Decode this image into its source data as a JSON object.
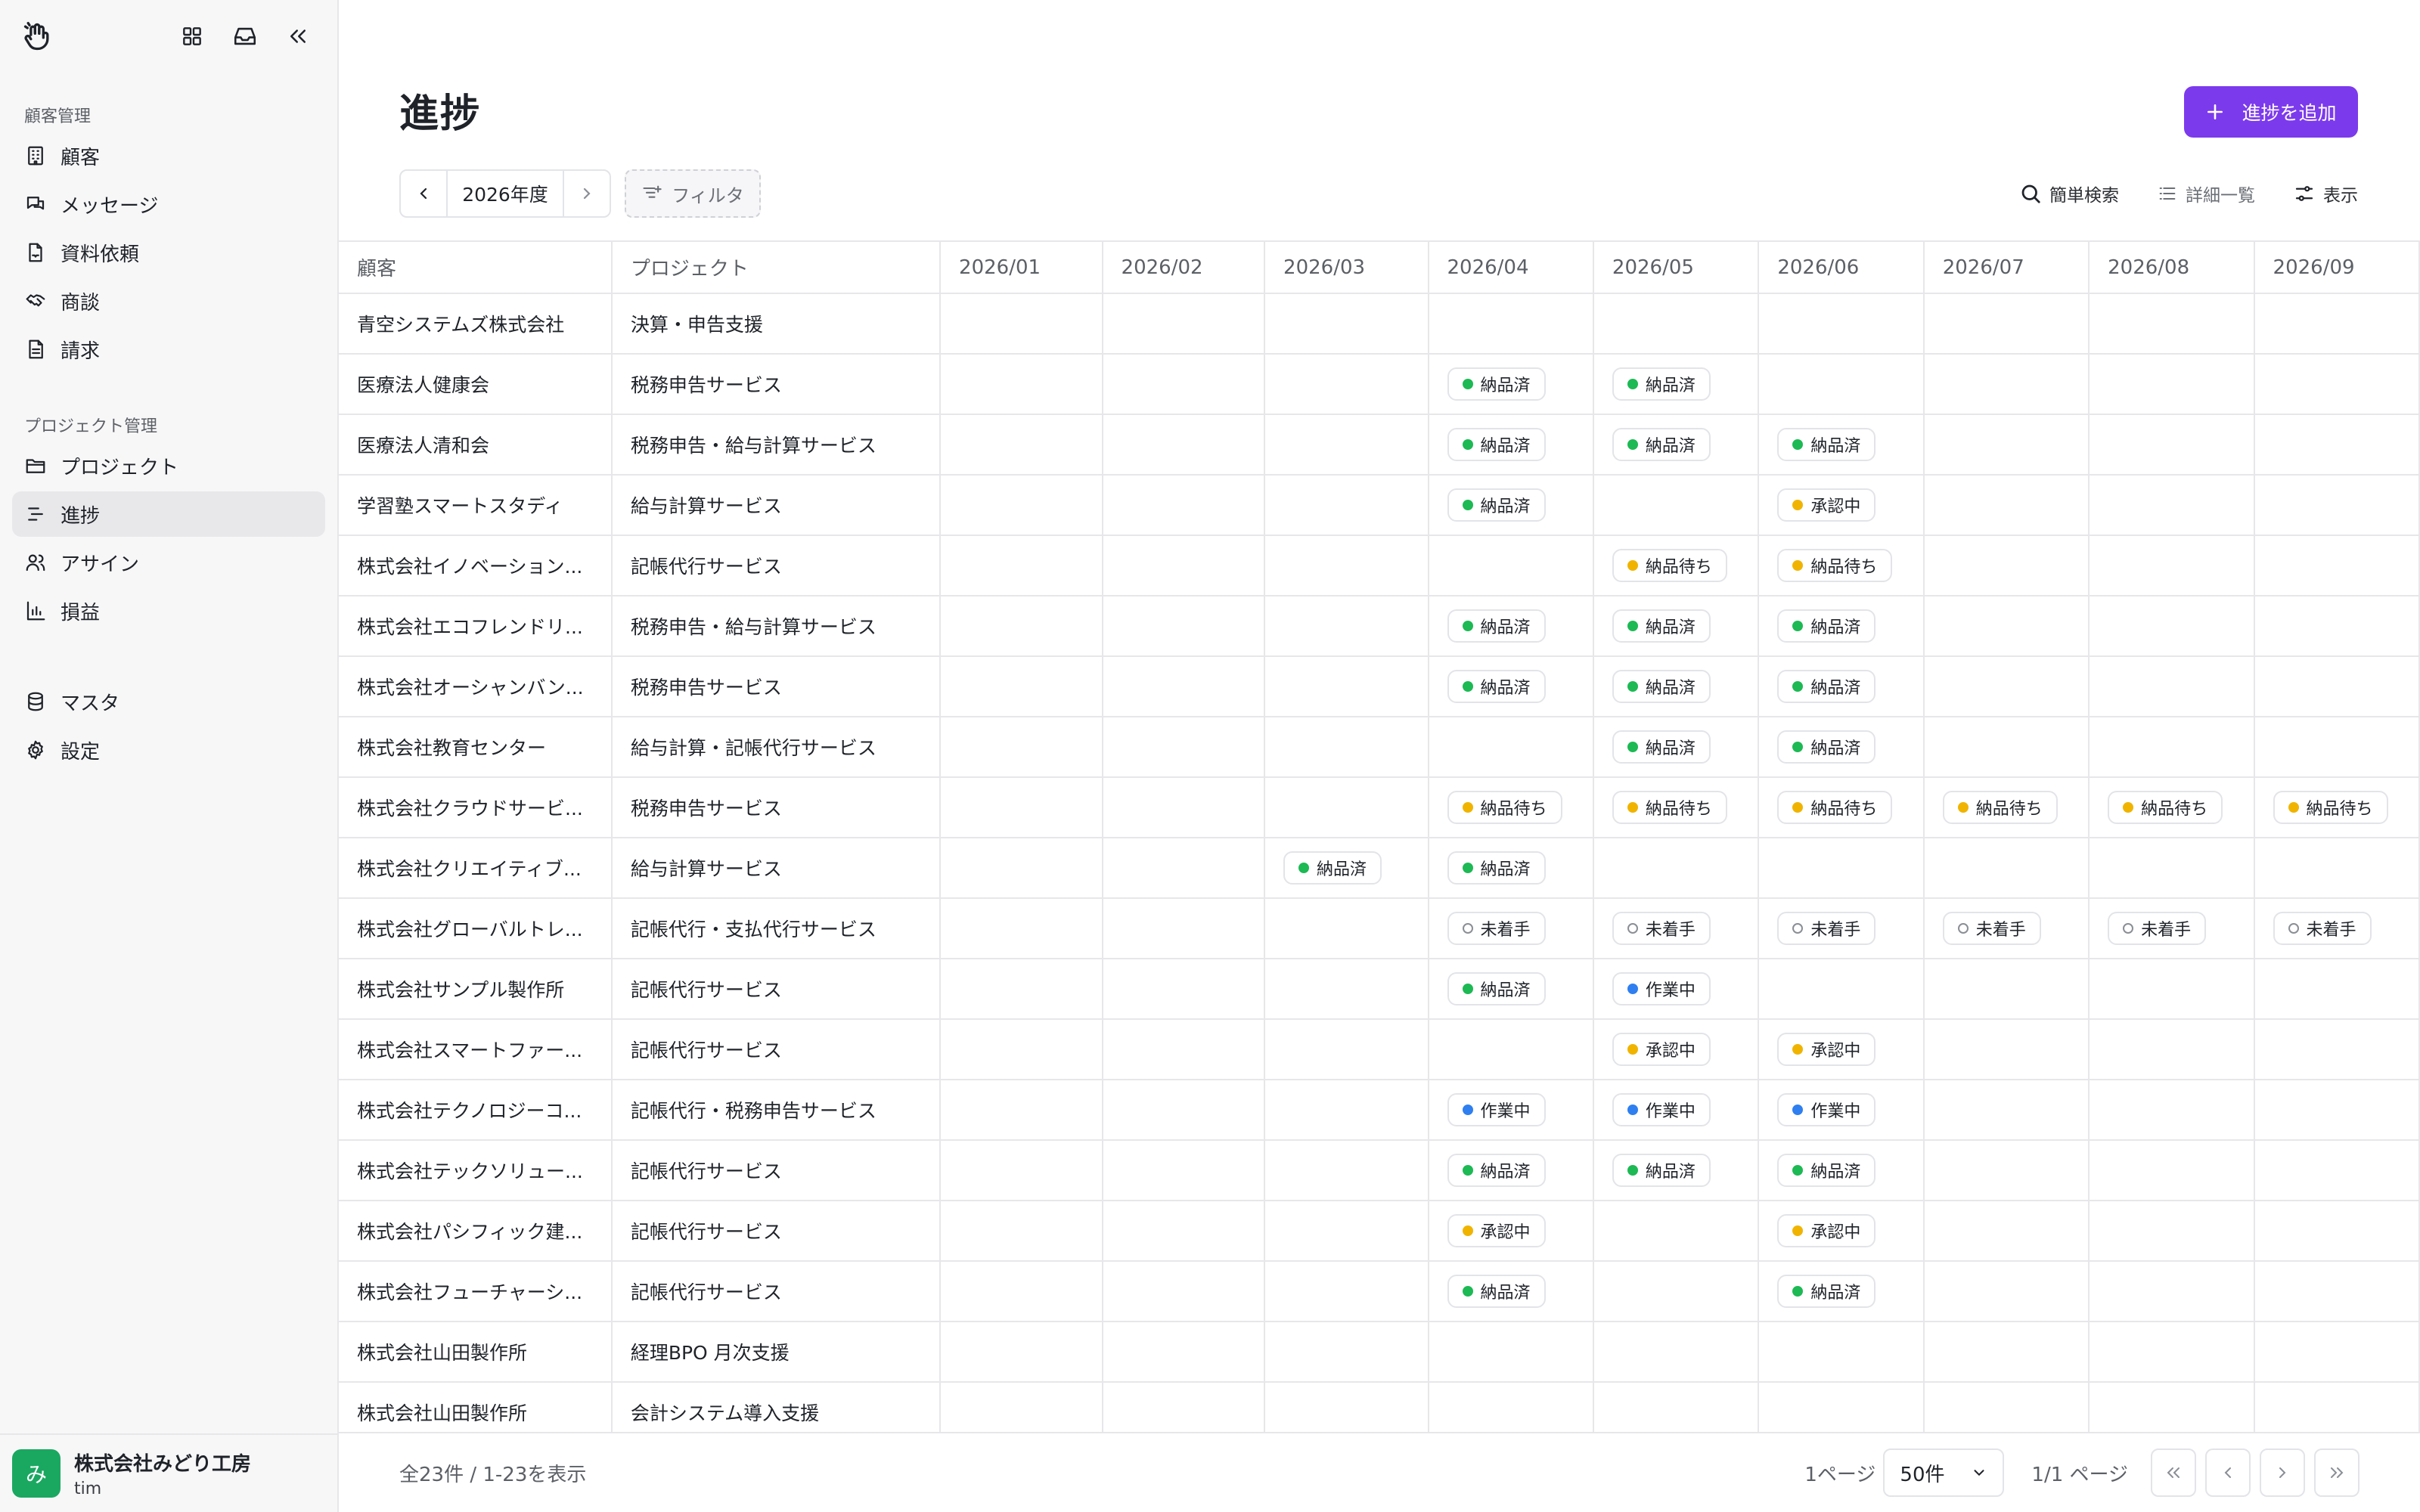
{
  "sidebar": {
    "sections": [
      {
        "title": "顧客管理",
        "items": [
          {
            "label": "顧客",
            "icon": "building-icon"
          },
          {
            "label": "メッセージ",
            "icon": "message-icon"
          },
          {
            "label": "資料依頼",
            "icon": "file-inbox-icon"
          },
          {
            "label": "商談",
            "icon": "handshake-icon"
          },
          {
            "label": "請求",
            "icon": "invoice-icon"
          }
        ]
      },
      {
        "title": "プロジェクト管理",
        "items": [
          {
            "label": "プロジェクト",
            "icon": "folder-icon"
          },
          {
            "label": "進捗",
            "icon": "progress-icon",
            "active": true
          },
          {
            "label": "アサイン",
            "icon": "users-icon"
          },
          {
            "label": "損益",
            "icon": "bar-chart-icon"
          }
        ]
      },
      {
        "title": "",
        "items": [
          {
            "label": "マスタ",
            "icon": "database-icon"
          },
          {
            "label": "設定",
            "icon": "gear-icon"
          }
        ]
      }
    ],
    "footer": {
      "avatar": "み",
      "org": "株式会社みどり工房",
      "user": "tim"
    }
  },
  "header": {
    "title": "進捗",
    "add_button": "進捗を追加"
  },
  "toolbar": {
    "year": "2026年度",
    "filter": "フィルタ",
    "quick_search": "簡単検索",
    "detail_list": "詳細一覧",
    "display": "表示"
  },
  "table": {
    "columns": [
      "顧客",
      "プロジェクト",
      "2026/01",
      "2026/02",
      "2026/03",
      "2026/04",
      "2026/05",
      "2026/06",
      "2026/07",
      "2026/08",
      "2026/09"
    ],
    "rows": [
      {
        "customer": "青空システムズ株式会社",
        "project": "決算・申告支援",
        "months": [
          "",
          "",
          "",
          "",
          "",
          "",
          "",
          "",
          ""
        ]
      },
      {
        "customer": "医療法人健康会",
        "project": "税務申告サービス",
        "months": [
          "",
          "",
          "",
          "納品済",
          "納品済",
          "",
          "",
          "",
          ""
        ]
      },
      {
        "customer": "医療法人清和会",
        "project": "税務申告・給与計算サービス",
        "months": [
          "",
          "",
          "",
          "納品済",
          "納品済",
          "納品済",
          "",
          "",
          ""
        ]
      },
      {
        "customer": "学習塾スマートスタディ",
        "project": "給与計算サービス",
        "months": [
          "",
          "",
          "",
          "納品済",
          "",
          "承認中",
          "",
          "",
          ""
        ]
      },
      {
        "customer": "株式会社イノベーション...",
        "project": "記帳代行サービス",
        "months": [
          "",
          "",
          "",
          "",
          "納品待ち",
          "納品待ち",
          "",
          "",
          ""
        ]
      },
      {
        "customer": "株式会社エコフレンドリ...",
        "project": "税務申告・給与計算サービス",
        "months": [
          "",
          "",
          "",
          "納品済",
          "納品済",
          "納品済",
          "",
          "",
          ""
        ]
      },
      {
        "customer": "株式会社オーシャンバン...",
        "project": "税務申告サービス",
        "months": [
          "",
          "",
          "",
          "納品済",
          "納品済",
          "納品済",
          "",
          "",
          ""
        ]
      },
      {
        "customer": "株式会社教育センター",
        "project": "給与計算・記帳代行サービス",
        "months": [
          "",
          "",
          "",
          "",
          "納品済",
          "納品済",
          "",
          "",
          ""
        ]
      },
      {
        "customer": "株式会社クラウドサービ...",
        "project": "税務申告サービス",
        "months": [
          "",
          "",
          "",
          "納品待ち",
          "納品待ち",
          "納品待ち",
          "納品待ち",
          "納品待ち",
          "納品待ち"
        ]
      },
      {
        "customer": "株式会社クリエイティブ...",
        "project": "給与計算サービス",
        "months": [
          "",
          "",
          "納品済",
          "納品済",
          "",
          "",
          "",
          "",
          ""
        ]
      },
      {
        "customer": "株式会社グローバルトレ...",
        "project": "記帳代行・支払代行サービス",
        "months": [
          "",
          "",
          "",
          "未着手",
          "未着手",
          "未着手",
          "未着手",
          "未着手",
          "未着手"
        ]
      },
      {
        "customer": "株式会社サンプル製作所",
        "project": "記帳代行サービス",
        "months": [
          "",
          "",
          "",
          "納品済",
          "作業中",
          "",
          "",
          "",
          ""
        ]
      },
      {
        "customer": "株式会社スマートファー...",
        "project": "記帳代行サービス",
        "months": [
          "",
          "",
          "",
          "",
          "承認中",
          "承認中",
          "",
          "",
          ""
        ]
      },
      {
        "customer": "株式会社テクノロジーコ...",
        "project": "記帳代行・税務申告サービス",
        "months": [
          "",
          "",
          "",
          "作業中",
          "作業中",
          "作業中",
          "",
          "",
          ""
        ]
      },
      {
        "customer": "株式会社テックソリュー...",
        "project": "記帳代行サービス",
        "months": [
          "",
          "",
          "",
          "納品済",
          "納品済",
          "納品済",
          "",
          "",
          ""
        ]
      },
      {
        "customer": "株式会社パシフィック建...",
        "project": "記帳代行サービス",
        "months": [
          "",
          "",
          "",
          "承認中",
          "",
          "承認中",
          "",
          "",
          ""
        ]
      },
      {
        "customer": "株式会社フューチャーシ...",
        "project": "記帳代行サービス",
        "months": [
          "",
          "",
          "",
          "納品済",
          "",
          "納品済",
          "",
          "",
          ""
        ]
      },
      {
        "customer": "株式会社山田製作所",
        "project": "経理BPO 月次支援",
        "months": [
          "",
          "",
          "",
          "",
          "",
          "",
          "",
          "",
          ""
        ]
      },
      {
        "customer": "株式会社山田製作所",
        "project": "会計システム導入支援",
        "months": [
          "",
          "",
          "",
          "",
          "",
          "",
          "",
          "",
          ""
        ]
      }
    ]
  },
  "status_colors": {
    "納品済": "#1db954",
    "納品待ち": "#f0b400",
    "承認中": "#f0b400",
    "作業中": "#2f7ff0",
    "未着手": "hollow"
  },
  "pager": {
    "total": "全23件 / 1-23を表示",
    "per_page_label": "1ページ",
    "per_page": "50件",
    "page_info": "1/1 ページ"
  },
  "colors": {
    "accent": "#7c3aed",
    "avatar": "#1aa861"
  }
}
